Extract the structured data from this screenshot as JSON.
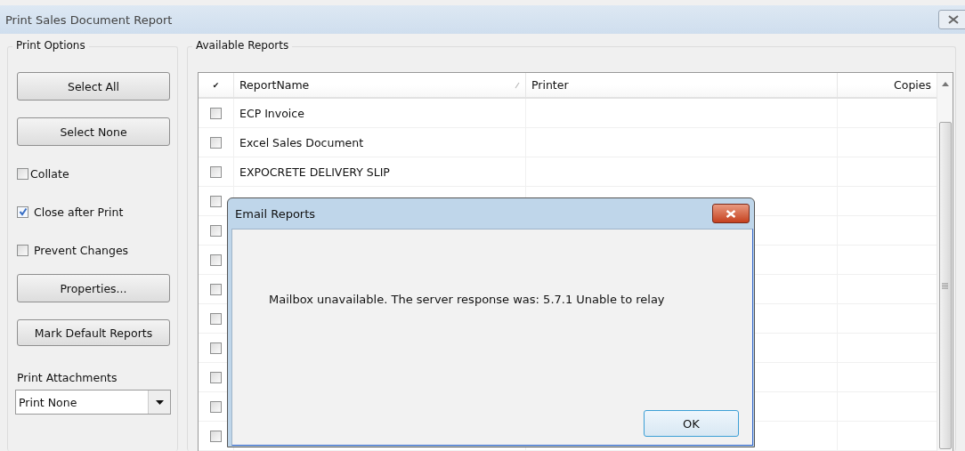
{
  "window": {
    "title": "Print Sales Document Report"
  },
  "print_options": {
    "title": "Print Options",
    "buttons": [
      "Select All",
      "Select None"
    ],
    "checkboxes": [
      {
        "label": "Collate",
        "checked": false
      },
      {
        "label": "Close after Print",
        "checked": true
      },
      {
        "label": "Prevent Changes",
        "checked": false
      }
    ],
    "buttons_2": [
      "Properties...",
      "Mark Default Reports"
    ],
    "attachments": {
      "label": "Print Attachments",
      "value": "Print None"
    }
  },
  "available_reports": {
    "title": "Available Reports",
    "columns": [
      "✔",
      "ReportName",
      "Printer",
      "Copies"
    ],
    "rows": [
      {
        "checked": false,
        "name": "ECP Invoice"
      },
      {
        "checked": false,
        "name": "Excel Sales Document"
      },
      {
        "checked": false,
        "name": "EXPOCRETE DELIVERY SLIP"
      },
      {
        "checked": false
      },
      {
        "checked": false
      },
      {
        "checked": false
      },
      {
        "checked": false
      },
      {
        "checked": false
      },
      {
        "checked": false
      },
      {
        "checked": false
      },
      {
        "checked": false
      },
      {
        "checked": false
      }
    ]
  },
  "dialog": {
    "title": "Email Reports",
    "message": "Mailbox unavailable. The server response was: 5.7.1 Unable to relay",
    "button": "OK"
  }
}
